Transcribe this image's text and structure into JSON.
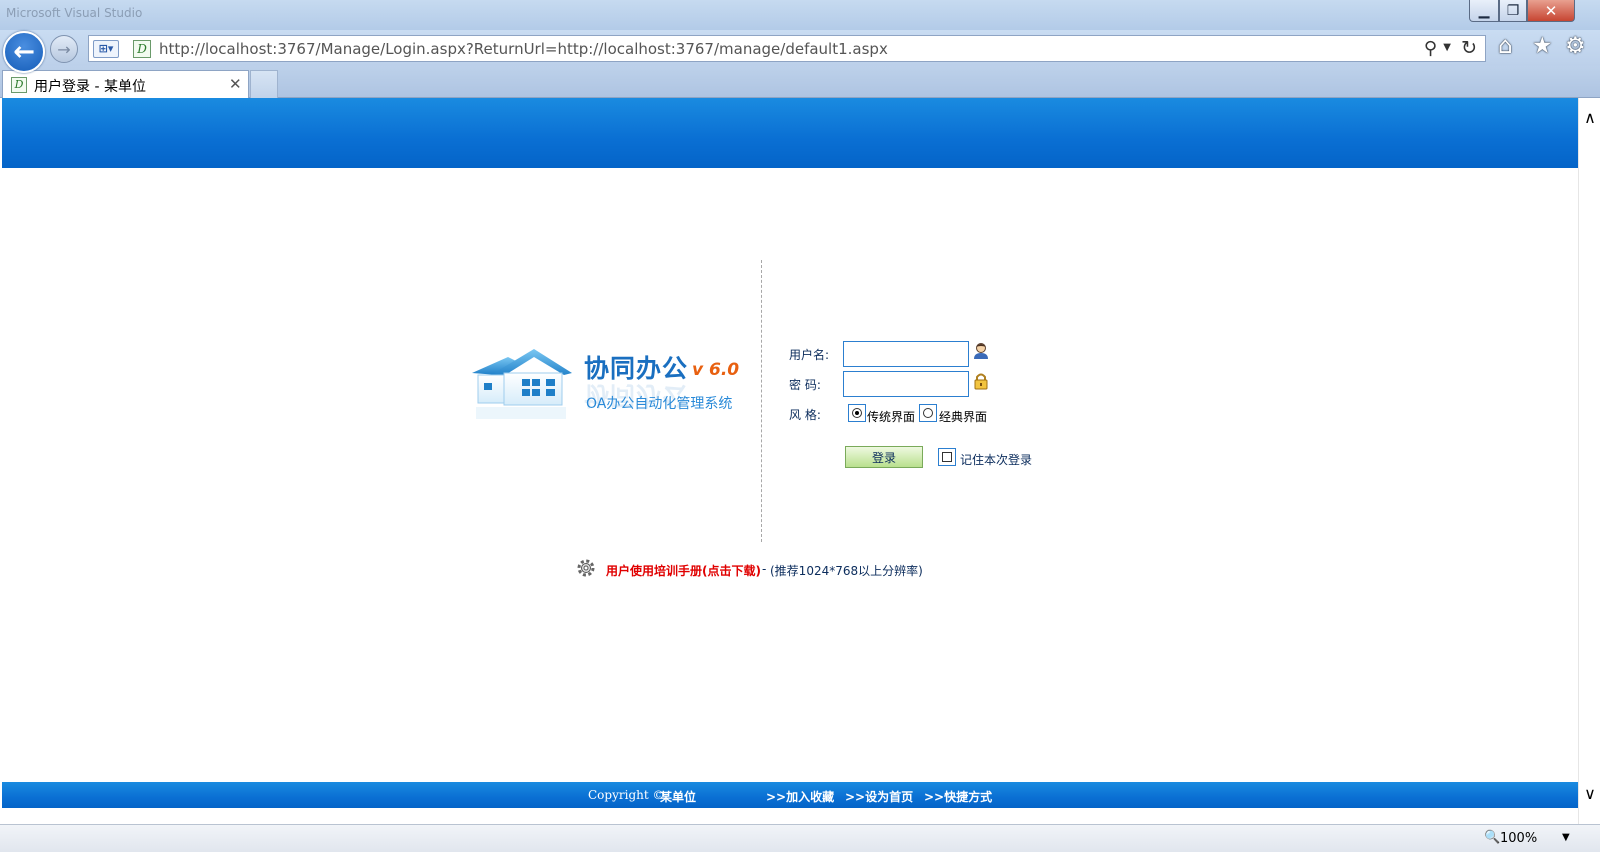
{
  "window": {
    "title": "Microsoft Visual Studio"
  },
  "browser": {
    "url": "http://localhost:3767/Manage/Login.aspx?ReturnUrl=http://localhost:3767/manage/default1.aspx",
    "tab_title": "用户登录 - 某单位",
    "zoom": "100%"
  },
  "logo": {
    "title": "协同办公",
    "version": "v 6.0",
    "subtitle": "OA办公自动化管理系统"
  },
  "login_form": {
    "username_label": "用户名:",
    "password_label": "密  码:",
    "style_label": "风  格:",
    "username_value": "",
    "password_value": "",
    "style_options": [
      {
        "label": "传统界面",
        "selected": true
      },
      {
        "label": "经典界面",
        "selected": false
      }
    ],
    "login_button": "登录",
    "remember_label": "记住本次登录",
    "remember_checked": false
  },
  "manual": {
    "link_text": "用户使用培训手册(点击下载)",
    "separator": " - ",
    "hint": "(推荐1024*768以上分辨率)"
  },
  "footer": {
    "copyright": "Copyright ©",
    "organization": "某单位",
    "links": [
      ">>加入收藏",
      ">>设为首页",
      ">>快捷方式"
    ]
  },
  "colors": {
    "header_blue": "#0a6fd3",
    "manual_link_red": "#e00000",
    "logo_orange": "#e86010"
  }
}
